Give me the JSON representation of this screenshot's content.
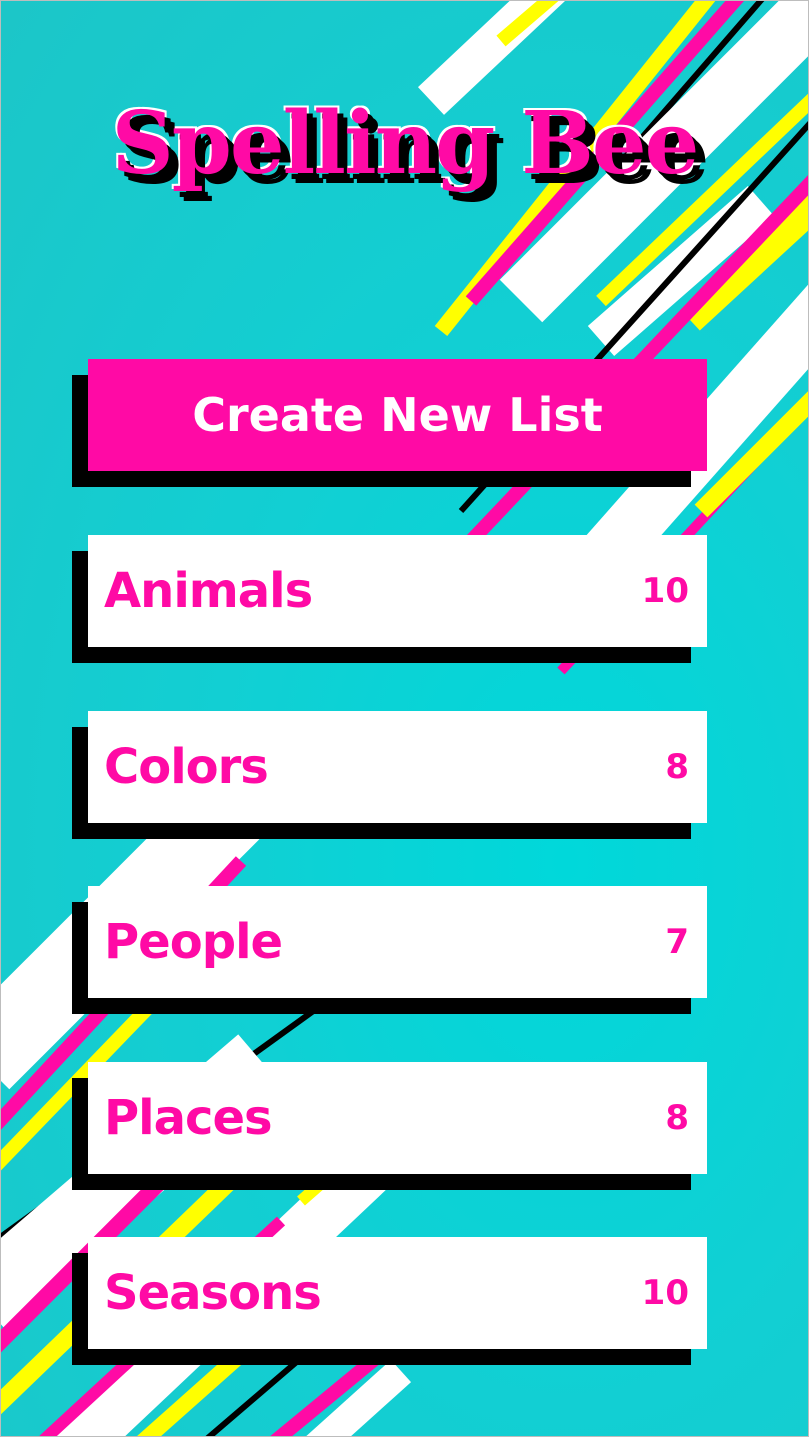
{
  "app": {
    "title": "Spelling Bee"
  },
  "actions": {
    "create_label": "Create New List"
  },
  "lists": [
    {
      "name": "Animals",
      "count": "10"
    },
    {
      "name": "Colors",
      "count": "8"
    },
    {
      "name": "People",
      "count": "7"
    },
    {
      "name": "Places",
      "count": "8"
    },
    {
      "name": "Seasons",
      "count": "10"
    }
  ],
  "colors": {
    "accent": "#ff0aa5",
    "background": "#12cfd3",
    "stripe_yellow": "#ffff00",
    "shadow": "#000000",
    "card": "#ffffff"
  }
}
